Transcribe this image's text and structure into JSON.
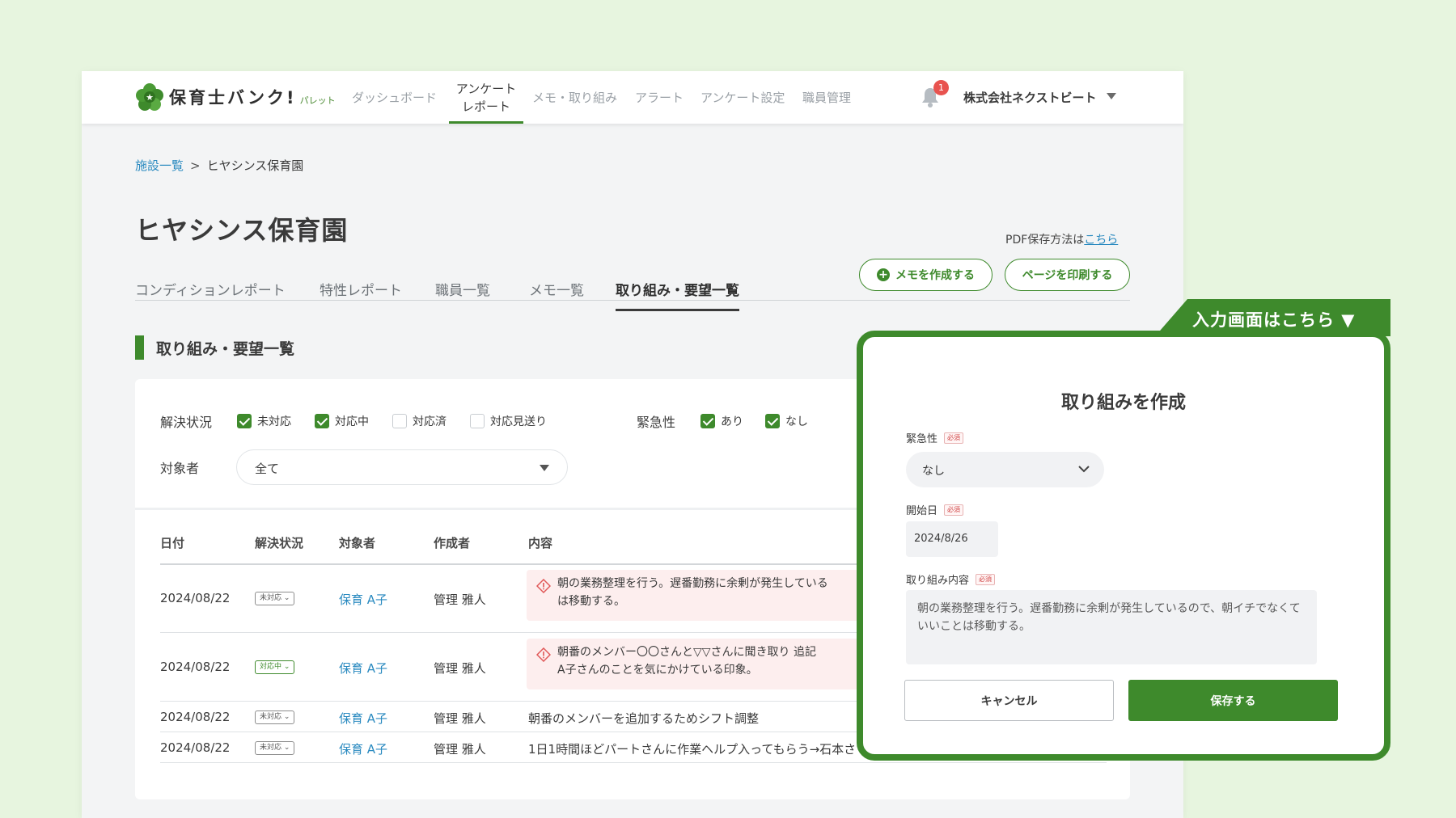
{
  "header": {
    "logo_text": "保育士バンク!",
    "logo_sub": "パレット",
    "nav": [
      {
        "label": "ダッシュボード"
      },
      {
        "label_line1": "アンケート",
        "label_line2": "レポート"
      },
      {
        "label": "メモ・取り組み"
      },
      {
        "label": "アラート"
      },
      {
        "label": "アンケート設定"
      },
      {
        "label": "職員管理"
      }
    ],
    "notification_count": "1",
    "company": "株式会社ネクストビート"
  },
  "breadcrumb": {
    "parent": "施設一覧",
    "separator": ">",
    "current": "ヒヤシンス保育園"
  },
  "page_title": "ヒヤシンス保育園",
  "pdf_help": {
    "text": "PDF保存方法は",
    "link": "こちら"
  },
  "actions": {
    "create_memo": "メモを作成する",
    "print_page": "ページを印刷する"
  },
  "tabs": [
    "コンディションレポート",
    "特性レポート",
    "職員一覧",
    "メモ一覧",
    "取り組み・要望一覧"
  ],
  "section_title": "取り組み・要望一覧",
  "filters": {
    "status_label": "解決状況",
    "status_options": [
      {
        "label": "未対応",
        "checked": true
      },
      {
        "label": "対応中",
        "checked": true
      },
      {
        "label": "対応済",
        "checked": false
      },
      {
        "label": "対応見送り",
        "checked": false
      }
    ],
    "urgency_label": "緊急性",
    "urgency_options": [
      {
        "label": "あり",
        "checked": true
      },
      {
        "label": "なし",
        "checked": true
      }
    ],
    "target_label": "対象者",
    "target_value": "全て"
  },
  "table": {
    "headers": [
      "日付",
      "解決状況",
      "対象者",
      "作成者",
      "内容"
    ],
    "rows": [
      {
        "date": "2024/08/22",
        "status": "未対応",
        "target": "保育 A子",
        "author": "管理 雅人",
        "content_line1": "朝の業務整理を行う。遅番勤務に余剰が発生している",
        "content_line2": "は移動する。",
        "urgent": true
      },
      {
        "date": "2024/08/22",
        "status": "対応中",
        "target": "保育 A子",
        "author": "管理 雅人",
        "content_line1": "朝番のメンバー〇〇さんと▽▽さんに聞き取り 追記",
        "content_line2": "A子さんのことを気にかけている印象。",
        "urgent": true
      },
      {
        "date": "2024/08/22",
        "status": "未対応",
        "target": "保育 A子",
        "author": "管理 雅人",
        "content_line1": "朝番のメンバーを追加するためシフト調整",
        "urgent": false
      },
      {
        "date": "2024/08/22",
        "status": "未対応",
        "target": "保育 A子",
        "author": "管理 雅人",
        "content_line1": "1日1時間ほどパートさんに作業ヘルプ入ってもらう→石本さ",
        "urgent": false
      }
    ]
  },
  "overlay": {
    "tab_label": "入力画面はこちら ▼",
    "title": "取り組みを作成",
    "required_badge": "必須",
    "urgency_label": "緊急性",
    "urgency_value": "なし",
    "start_label": "開始日",
    "start_value": "2024/8/26",
    "content_label": "取り組み内容",
    "content_value": "朝の業務整理を行う。遅番勤務に余剰が発生しているので、朝イチでなくていいことは移動する。",
    "cancel": "キャンセル",
    "save": "保存する"
  },
  "colors": {
    "brand_green": "#3e8a2c",
    "link_blue": "#2a8ac0",
    "badge_red": "#e8534f",
    "alert_bg": "#fdeeee"
  }
}
